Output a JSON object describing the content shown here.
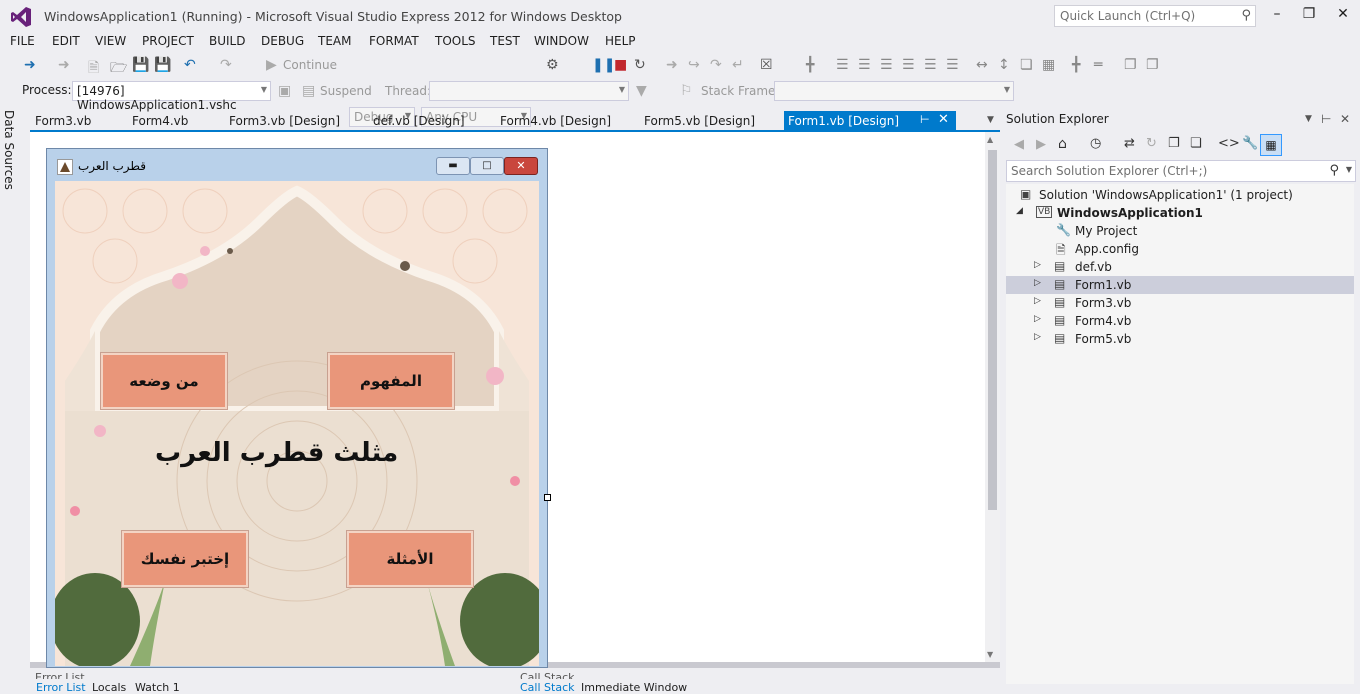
{
  "window": {
    "title": "WindowsApplication1 (Running) - Microsoft Visual Studio Express 2012 for Windows Desktop",
    "quick_launch_placeholder": "Quick Launch (Ctrl+Q)"
  },
  "menu": [
    "FILE",
    "EDIT",
    "VIEW",
    "PROJECT",
    "BUILD",
    "DEBUG",
    "TEAM",
    "FORMAT",
    "TOOLS",
    "TEST",
    "WINDOW",
    "HELP"
  ],
  "toolbar1": {
    "continue_label": "Continue",
    "config_value": "Debug",
    "platform_value": "Any CPU"
  },
  "toolbar2": {
    "process_label": "Process:",
    "process_value": "[14976] WindowsApplication1.vshc",
    "suspend_label": "Suspend",
    "thread_label": "Thread:",
    "stack_frame_label": "Stack Frame:"
  },
  "left_strip": {
    "data_sources": "Data Sources"
  },
  "doc_tabs": [
    "Form3.vb",
    "Form4.vb",
    "Form3.vb [Design]",
    "def.vb [Design]",
    "Form4.vb [Design]",
    "Form5.vb [Design]"
  ],
  "active_tab": "Form1.vb [Design]",
  "form": {
    "title": "قطرب العرب",
    "heading": "مثلث قطرب العرب",
    "buttons": {
      "top_left": "من وضعه",
      "top_right": "المفهوم",
      "bottom_left": "إختبر نفسك",
      "bottom_right": "الأمثلة"
    }
  },
  "solution_explorer": {
    "header": "Solution Explorer",
    "search_placeholder": "Search Solution Explorer (Ctrl+;)",
    "tree": {
      "solution": "Solution 'WindowsApplication1' (1 project)",
      "project": "WindowsApplication1",
      "items": [
        "My Project",
        "App.config",
        "def.vb",
        "Form1.vb",
        "Form3.vb",
        "Form4.vb",
        "Form5.vb"
      ]
    }
  },
  "bottom_panels": {
    "left_title": "Error List",
    "left_tabs": [
      "Error List",
      "Locals",
      "Watch 1"
    ],
    "right_title": "Call Stack",
    "right_tabs": [
      "Call Stack",
      "Immediate Window"
    ]
  },
  "colors": {
    "accent": "#007acc",
    "form_button": "#e9967a",
    "form_background": "#f6e3d6",
    "selected_row": "#cccedb"
  }
}
